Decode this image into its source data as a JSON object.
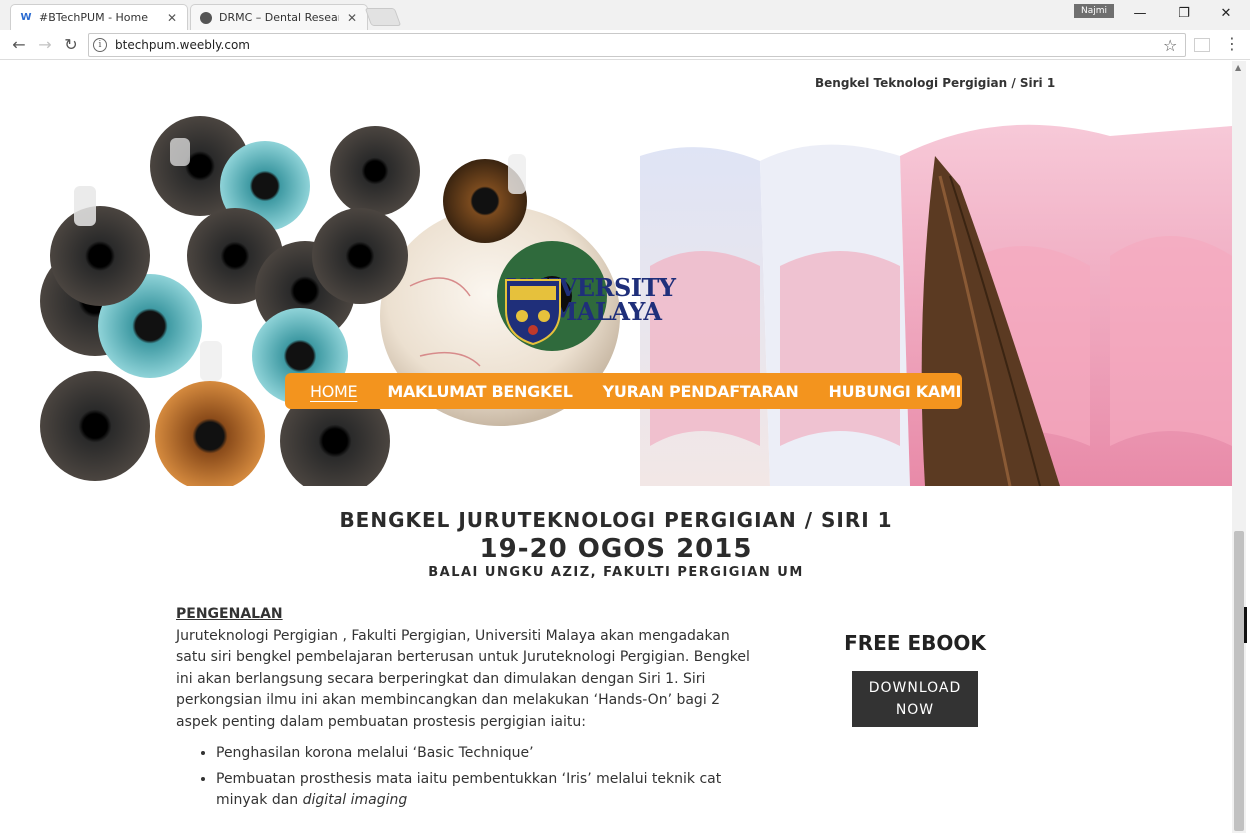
{
  "browser": {
    "tabs": [
      {
        "title": "#BTechPUM - Home",
        "favicon": "weebly-icon",
        "active": true
      },
      {
        "title": "DRMC – Dental Research",
        "favicon": "drmc-icon",
        "active": false
      }
    ],
    "user": "Najmi",
    "url": "btechpum.weebly.com"
  },
  "page": {
    "tagline": "Bengkel Teknologi Pergigian / Siri 1",
    "logo": {
      "line1": "UNIVERSITY",
      "line2": "OF MALAYA"
    },
    "nav": [
      "HOME",
      "MAKLUMAT BENGKEL",
      "YURAN PENDAFTARAN",
      "HUBUNGI KAMI"
    ],
    "headline": {
      "title": "BENGKEL JURUTEKNOLOGI PERGIGIAN / SIRI 1",
      "date": "19-20 OGOS 2015",
      "venue": "BALAI UNGKU AZIZ, FAKULTI PERGIGIAN UM"
    },
    "intro": {
      "heading": "PENGENALAN",
      "body": "Juruteknologi Pergigian , Fakulti Pergigian, Universiti Malaya akan mengadakan satu siri bengkel pembelajaran berterusan untuk Juruteknologi Pergigian. Bengkel ini akan berlangsung secara berperingkat dan dimulakan dengan Siri 1. Siri perkongsian ilmu ini akan membincangkan dan melakukan ‘Hands-On’ bagi 2 aspek penting dalam pembuatan prostesis pergigian iaitu:",
      "bullets": [
        "Penghasilan korona melalui ‘Basic Technique’",
        "Pembuatan prosthesis mata iaitu pembentukkan ‘Iris’ melalui teknik cat minyak dan "
      ],
      "bullet2_italic": "digital imaging"
    },
    "ebook": {
      "title": "FREE EBOOK",
      "button_line1": "DOWNLOAD",
      "button_line2": "NOW"
    }
  },
  "colors": {
    "nav_bg": "#f3941e",
    "logo_blue": "#1f2f7a",
    "button_bg": "#333333"
  }
}
